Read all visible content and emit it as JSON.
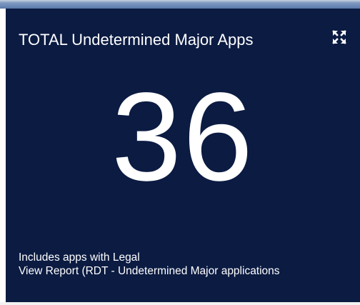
{
  "tile": {
    "title": "TOTAL Undetermined Major Apps",
    "value": "36",
    "footnote_line1": "Includes apps with Legal",
    "report_link": "View Report (RDT - Undetermined Major applications",
    "expand_icon": "expand-arrows-icon",
    "background_color": "#0b1b42",
    "text_color": "#ffffff"
  }
}
